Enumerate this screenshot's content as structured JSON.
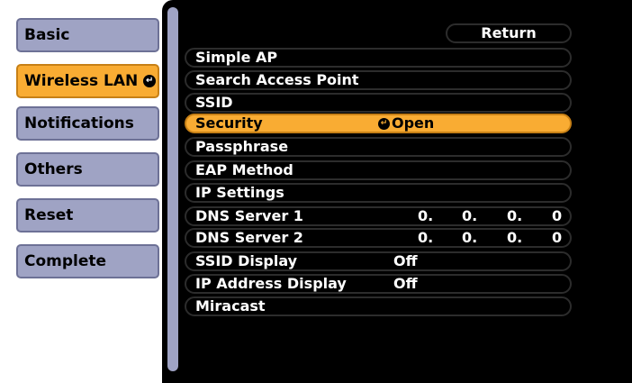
{
  "menu": {
    "items": [
      {
        "label": "Basic"
      },
      {
        "label": "Wireless LAN",
        "active": true
      },
      {
        "label": "Notifications"
      },
      {
        "label": "Others"
      },
      {
        "label": "Reset"
      },
      {
        "label": "Complete"
      }
    ]
  },
  "panel": {
    "return_label": "Return",
    "rows": [
      {
        "label": "Simple AP"
      },
      {
        "label": "Search Access Point"
      },
      {
        "label": "SSID"
      },
      {
        "label": "Security",
        "value": "Open",
        "selected": true
      },
      {
        "label": "Passphrase"
      },
      {
        "label": "EAP Method"
      },
      {
        "label": "IP Settings"
      },
      {
        "label": "DNS Server 1",
        "octets": [
          "0.",
          "0.",
          "0.",
          "0"
        ]
      },
      {
        "label": "DNS Server 2",
        "octets": [
          "0.",
          "0.",
          "0.",
          "0"
        ]
      },
      {
        "label": "SSID Display",
        "value": "Off"
      },
      {
        "label": "IP Address Display",
        "value": "Off"
      },
      {
        "label": "Miracast"
      }
    ]
  },
  "colors": {
    "accent": "#f9ac33",
    "menu_bg": "#9fa3c4",
    "panel_bg": "#000000"
  }
}
